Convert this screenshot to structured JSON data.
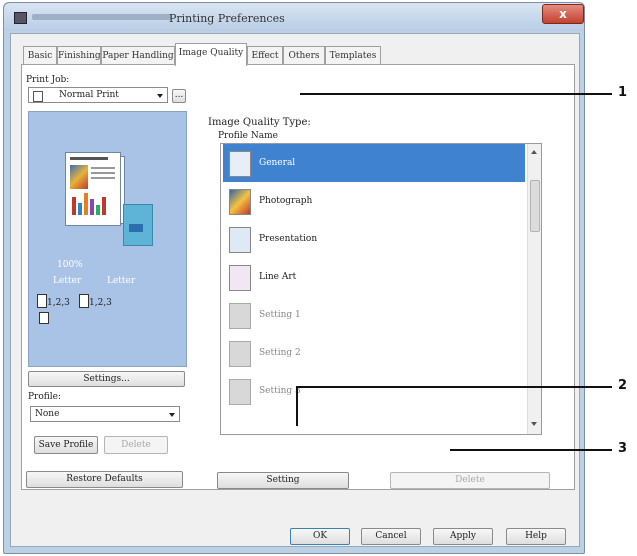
{
  "window": {
    "title": "Printing Preferences",
    "close_glyph": "x"
  },
  "tabs": [
    {
      "label": "Basic"
    },
    {
      "label": "Finishing"
    },
    {
      "label": "Paper Handling"
    },
    {
      "label": "Image Quality",
      "active": true
    },
    {
      "label": "Effect"
    },
    {
      "label": "Others"
    },
    {
      "label": "Templates"
    }
  ],
  "left": {
    "print_job_label": "Print Job:",
    "print_job_value": "Normal Print",
    "print_job_extra_button": "...",
    "preview": {
      "zoom": "100%",
      "paper_left": "Letter",
      "paper_right": "Letter",
      "collate_a": "1,2,3",
      "collate_b": "1,2,3"
    },
    "settings_button": "Settings...",
    "profile_label": "Profile:",
    "profile_value": "None",
    "save_profile_button": "Save Profile",
    "delete_profile_button": "Delete",
    "restore_defaults_button": "Restore Defaults"
  },
  "main": {
    "image_quality_type_label": "Image Quality Type:",
    "profile_name_label": "Profile Name",
    "profiles": [
      {
        "label": "General",
        "selected": true,
        "icon": "general-doc-icon"
      },
      {
        "label": "Photograph",
        "icon": "photograph-doc-icon"
      },
      {
        "label": "Presentation",
        "icon": "presentation-doc-icon"
      },
      {
        "label": "Line Art",
        "icon": "line-art-doc-icon"
      },
      {
        "label": "Setting 1",
        "icon": "custom-setting-icon"
      },
      {
        "label": "Setting 2",
        "icon": "custom-setting-icon"
      },
      {
        "label": "Setting 3",
        "icon": "custom-setting-icon"
      }
    ],
    "setting_button": "Setting",
    "delete_button": "Delete"
  },
  "footer": {
    "ok": "OK",
    "cancel": "Cancel",
    "apply": "Apply",
    "help": "Help"
  },
  "callouts": [
    "1",
    "2",
    "3"
  ],
  "colors": {
    "selection": "#3f83d0",
    "preview_bg": "#a9c3e6",
    "close_red": "#c3422f"
  }
}
